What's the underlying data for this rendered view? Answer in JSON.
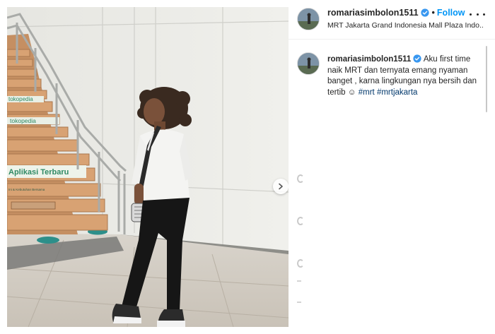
{
  "post": {
    "username": "romariasimbolon1511",
    "verified": true,
    "follow_label": "Follow",
    "separator": "•",
    "location": "MRT Jakarta Grand Indonesia Mall Plaza Indo..."
  },
  "caption": {
    "username": "romariasimbolon1511",
    "text": "Aku first time naik MRT dan ternyata emang nyaman banget , karna lingkungan nya bersih dan tertib",
    "emoji": "☺",
    "hashtags": [
      "#mrt",
      "#mrtjakarta"
    ]
  },
  "photo": {
    "signage_top": "tokopedia",
    "signage_mid": "tokopedia",
    "signage_app": "Aplikasi Terbaru",
    "signage_small": "Ini & Kebutuhan Bersama"
  },
  "icons": {
    "verified": "verified-badge-icon",
    "more": "more-options-icon",
    "next": "chevron-right-icon"
  },
  "colors": {
    "follow": "#0095f6",
    "hashtag": "#00376b",
    "verified": "#3897f0",
    "stair_sign": "#2f8a64"
  }
}
